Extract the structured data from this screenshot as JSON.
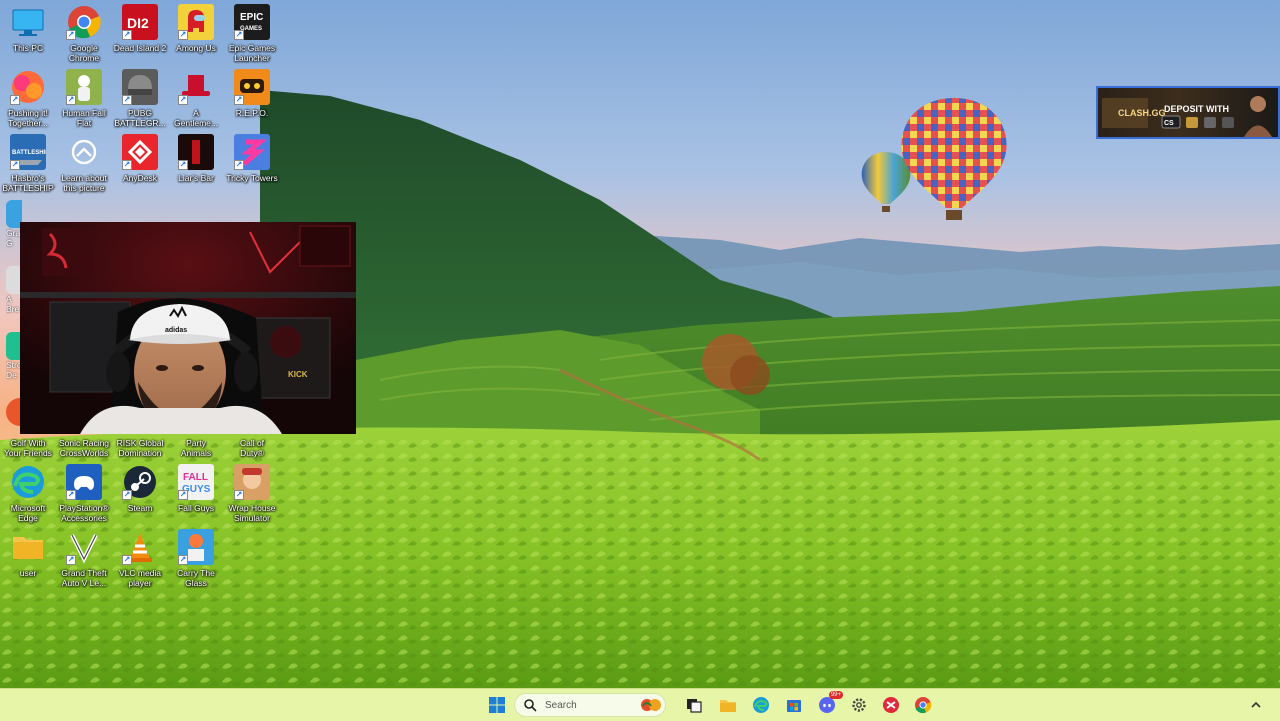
{
  "desktop": {
    "icons": [
      {
        "id": "this-pc",
        "label": "This PC"
      },
      {
        "id": "google-chrome",
        "label": "Google\nChrome"
      },
      {
        "id": "dead-island-2",
        "label": "Dead Island 2",
        "art": "DI2"
      },
      {
        "id": "among-us",
        "label": "Among Us"
      },
      {
        "id": "epic-games",
        "label": "Epic Games\nLauncher",
        "art": "EPIC\nGAMES"
      },
      {
        "id": "pushing-it-together",
        "label": "Pushing it!\nTogether..."
      },
      {
        "id": "human-fall-flat",
        "label": "Human Fall\nFlat"
      },
      {
        "id": "pubg",
        "label": "PUBG\nBATTLEGR..."
      },
      {
        "id": "a-gentleman",
        "label": "A\nGentleme..."
      },
      {
        "id": "repo",
        "label": "R.E.P.O."
      },
      {
        "id": "battleship",
        "label": "Hasbro's\nBATTLESHIP",
        "art": "BATTLESHIP"
      },
      {
        "id": "learn-about-picture",
        "label": "Learn about\nthis picture"
      },
      {
        "id": "anydesk",
        "label": "AnyDesk"
      },
      {
        "id": "liars-bar",
        "label": "Liar's Bar"
      },
      {
        "id": "tricky-towers",
        "label": "Tricky Towers"
      },
      {
        "id": "golf-with-friends",
        "label": "Golf With\nYour Friends"
      },
      {
        "id": "sonic-racing",
        "label": "Sonic Racing\nCrossWorlds"
      },
      {
        "id": "risk-global",
        "label": "RISK Global\nDomination"
      },
      {
        "id": "party-animals",
        "label": "Party\nAnimals"
      },
      {
        "id": "call-of-duty",
        "label": "Call of\nDuty®"
      },
      {
        "id": "microsoft-edge",
        "label": "Microsoft\nEdge"
      },
      {
        "id": "ps-accessories",
        "label": "PlayStation®\nAccessories"
      },
      {
        "id": "steam",
        "label": "Steam"
      },
      {
        "id": "fall-guys",
        "label": "Fall Guys",
        "art": "FALL\nGUYS"
      },
      {
        "id": "wrap-house",
        "label": "Wrap House\nSimulator"
      },
      {
        "id": "user-folder",
        "label": "user"
      },
      {
        "id": "gta-v",
        "label": "Grand Theft\nAuto V Le..."
      },
      {
        "id": "vlc",
        "label": "VLC media\nplayer"
      },
      {
        "id": "carry-the-glass",
        "label": "Carry The\nGlass"
      }
    ],
    "partial_labels": {
      "gra": "Gra\nG",
      "bre": "A\nBre",
      "stre": "Stre\nDe"
    }
  },
  "webcam": {
    "cap_brand": "adidas",
    "shelf_sign": "KICK"
  },
  "ad_banner": {
    "brand": "CLASH.GG",
    "headline": "DEPOSIT WITH",
    "badge": "CS"
  },
  "taskbar": {
    "search_placeholder": "Search",
    "discord_badge": "99+",
    "apps": [
      "start-icon",
      "search-icon",
      "task-view-icon",
      "file-explorer-icon",
      "edge-icon",
      "store-icon",
      "discord-icon",
      "settings-icon",
      "app-red-icon",
      "chrome-icon"
    ],
    "tray_chevron": "^"
  }
}
